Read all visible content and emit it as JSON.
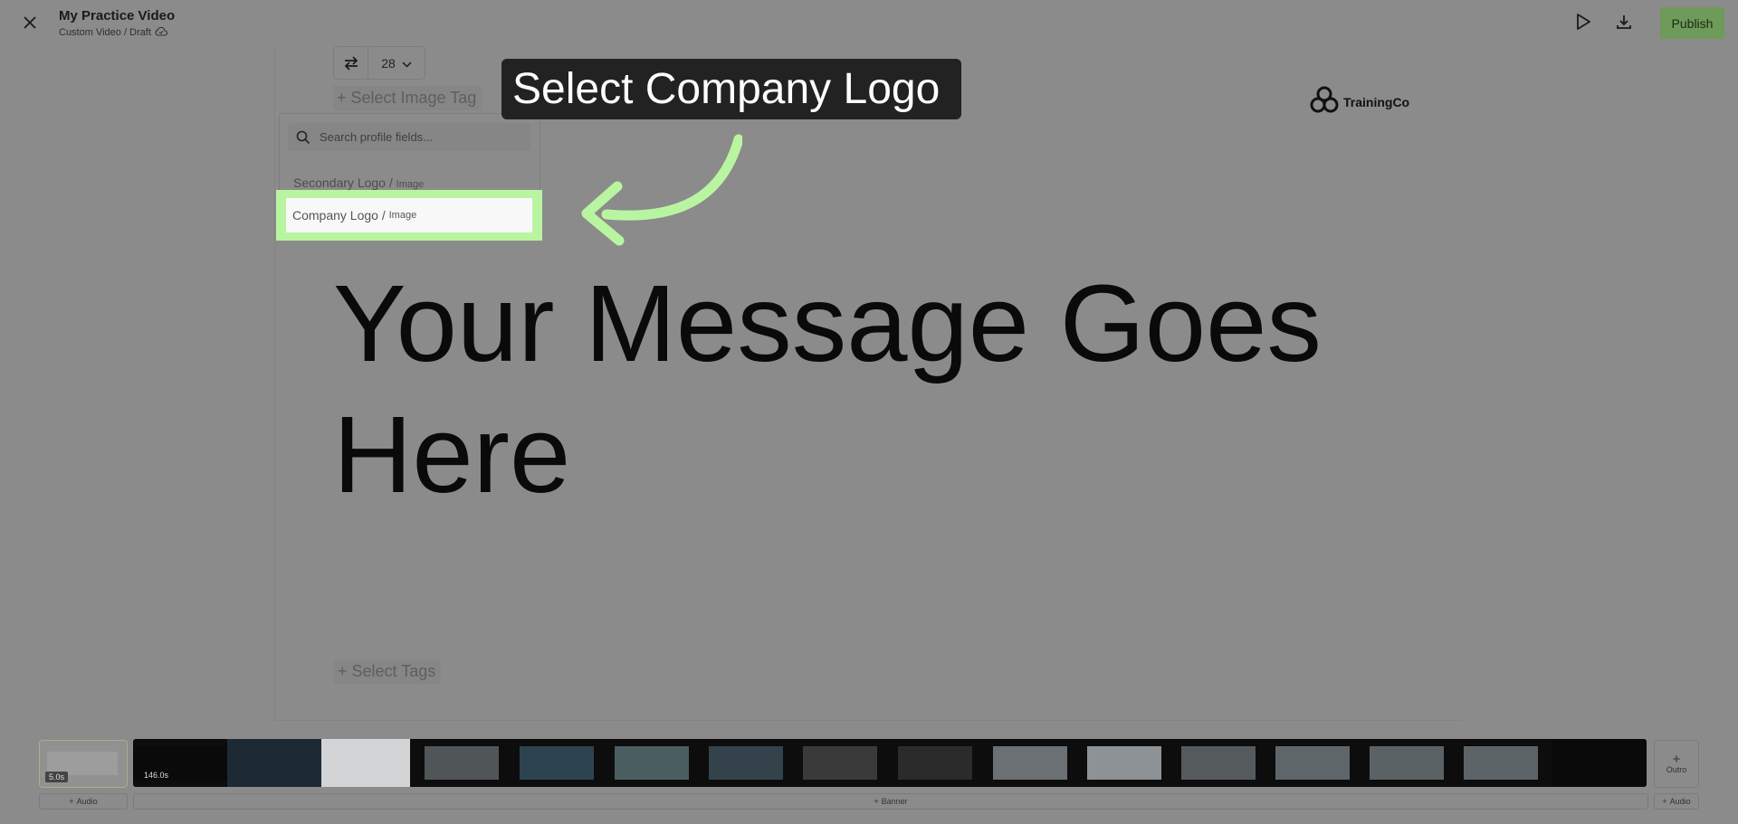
{
  "header": {
    "title": "My Practice Video",
    "subtitle": "Custom Video / Draft",
    "publish_label": "Publish"
  },
  "toolbar": {
    "font_size": "28"
  },
  "canvas": {
    "select_image_tag": "Select Image Tag",
    "select_tags": "Select Tags",
    "message": "Your Message Goes Here",
    "logo_text": "TrainingCo"
  },
  "dropdown": {
    "search_placeholder": "Search profile fields...",
    "options": [
      {
        "label": "Secondary Logo",
        "type": "Image"
      },
      {
        "label": "Company Logo",
        "type": "Image"
      }
    ]
  },
  "callout": {
    "text": "Select Company Logo"
  },
  "timeline": {
    "intro_duration": "5.0s",
    "main_duration": "146.0s",
    "outro_label": "Outro",
    "add_audio_left": "Audio",
    "add_banner": "Banner",
    "add_audio_right": "Audio"
  },
  "colors": {
    "highlight": "#b9f5a0",
    "publish": "#6e9a5a",
    "callout": "#222222"
  }
}
